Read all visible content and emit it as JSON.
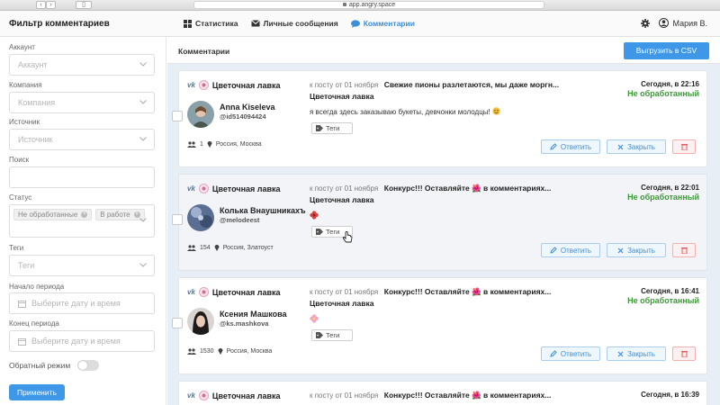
{
  "browser": {
    "url": "app.angry.space"
  },
  "header": {
    "title": "Фильтр комментариев",
    "nav": [
      {
        "label": "Статистика",
        "icon": "grid-icon",
        "active": false
      },
      {
        "label": "Личные сообщения",
        "icon": "envelope-icon",
        "active": false
      },
      {
        "label": "Комментарии",
        "icon": "chat-bubble-icon",
        "active": true
      }
    ],
    "user_name": "Мария В."
  },
  "sidebar": {
    "account_label": "Аккаунт",
    "account_placeholder": "Аккаунт",
    "company_label": "Компания",
    "company_placeholder": "Компания",
    "source_label": "Источник",
    "source_placeholder": "Источник",
    "search_label": "Поиск",
    "status_label": "Статус",
    "status_selected": [
      "Не обработанные",
      "В работе"
    ],
    "tags_label": "Теги",
    "tags_placeholder": "Теги",
    "period_start_label": "Начало периода",
    "period_start_placeholder": "Выберите дату и время",
    "period_end_label": "Конец периода",
    "period_end_placeholder": "Выберите дату и время",
    "reverse_mode_label": "Обратный режим",
    "reverse_mode_on": false,
    "apply_label": "Применить"
  },
  "main": {
    "title": "Комментарии",
    "export_label": "Выгрузить в CSV",
    "comments": [
      {
        "network": "vk",
        "group": "Цветочная лавка",
        "author_name": "Anna Kiseleva",
        "author_handle": "@id514094424",
        "followers": "1",
        "location": "Россия, Москва",
        "post_ref": "к посту от 01 ноября",
        "post_title": "Свежие пионы разлетаются, мы даже моргн...",
        "comment_group": "Цветочная лавка",
        "comment_text": "я всегда здесь заказываю букеты, девчонки молодцы!",
        "tags_label": "Теги",
        "date": "Сегодня, в 22:16",
        "status": "Не обработанный",
        "reply_label": "Ответить",
        "close_label": "Закрыть"
      },
      {
        "network": "vk",
        "group": "Цветочная лавка",
        "author_name": "Колька Внаушникахъ",
        "author_handle": "@melodeest",
        "followers": "154",
        "location": "Россия, Златоуст",
        "post_ref": "к посту от 01 ноября",
        "post_title": "Конкурс!!! Оставляйте 🌺 в комментариях...",
        "comment_group": "Цветочная лавка",
        "comment_text": "",
        "tags_label": "Теги",
        "date": "Сегодня, в 22:01",
        "status": "Не обработанный",
        "reply_label": "Ответить",
        "close_label": "Закрыть"
      },
      {
        "network": "vk",
        "group": "Цветочная лавка",
        "author_name": "Ксения Машкова",
        "author_handle": "@ks.mashkova",
        "followers": "1530",
        "location": "Россия, Москва",
        "post_ref": "к посту от 01 ноября",
        "post_title": "Конкурс!!! Оставляйте 🌺 в комментариях...",
        "comment_group": "Цветочная лавка",
        "comment_text": "",
        "tags_label": "Теги",
        "date": "Сегодня, в 16:41",
        "status": "Не обработанный",
        "reply_label": "Ответить",
        "close_label": "Закрыть"
      },
      {
        "network": "vk",
        "group": "Цветочная лавка",
        "post_ref": "к посту от 01 ноября",
        "post_title": "Конкурс!!! Оставляйте 🌺 в комментариях...",
        "date": "Сегодня, в 16:39"
      }
    ]
  },
  "colors": {
    "accent": "#3f97e8",
    "status_green": "#3c9a37",
    "vk_blue": "#4a76a8"
  }
}
